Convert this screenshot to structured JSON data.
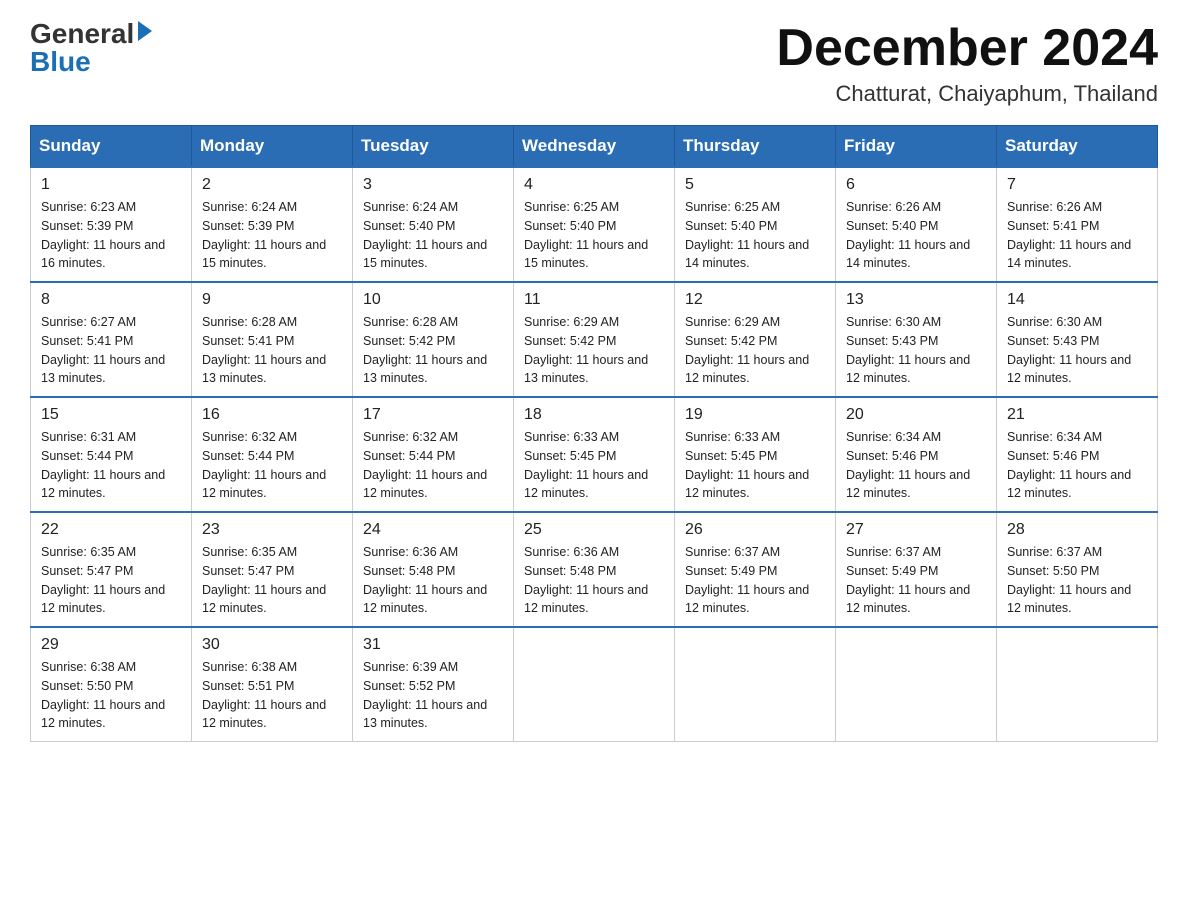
{
  "logo": {
    "general": "General",
    "blue": "Blue"
  },
  "title": {
    "month_year": "December 2024",
    "location": "Chatturat, Chaiyaphum, Thailand"
  },
  "headers": [
    "Sunday",
    "Monday",
    "Tuesday",
    "Wednesday",
    "Thursday",
    "Friday",
    "Saturday"
  ],
  "weeks": [
    [
      {
        "day": "1",
        "sunrise": "6:23 AM",
        "sunset": "5:39 PM",
        "daylight": "11 hours and 16 minutes."
      },
      {
        "day": "2",
        "sunrise": "6:24 AM",
        "sunset": "5:39 PM",
        "daylight": "11 hours and 15 minutes."
      },
      {
        "day": "3",
        "sunrise": "6:24 AM",
        "sunset": "5:40 PM",
        "daylight": "11 hours and 15 minutes."
      },
      {
        "day": "4",
        "sunrise": "6:25 AM",
        "sunset": "5:40 PM",
        "daylight": "11 hours and 15 minutes."
      },
      {
        "day": "5",
        "sunrise": "6:25 AM",
        "sunset": "5:40 PM",
        "daylight": "11 hours and 14 minutes."
      },
      {
        "day": "6",
        "sunrise": "6:26 AM",
        "sunset": "5:40 PM",
        "daylight": "11 hours and 14 minutes."
      },
      {
        "day": "7",
        "sunrise": "6:26 AM",
        "sunset": "5:41 PM",
        "daylight": "11 hours and 14 minutes."
      }
    ],
    [
      {
        "day": "8",
        "sunrise": "6:27 AM",
        "sunset": "5:41 PM",
        "daylight": "11 hours and 13 minutes."
      },
      {
        "day": "9",
        "sunrise": "6:28 AM",
        "sunset": "5:41 PM",
        "daylight": "11 hours and 13 minutes."
      },
      {
        "day": "10",
        "sunrise": "6:28 AM",
        "sunset": "5:42 PM",
        "daylight": "11 hours and 13 minutes."
      },
      {
        "day": "11",
        "sunrise": "6:29 AM",
        "sunset": "5:42 PM",
        "daylight": "11 hours and 13 minutes."
      },
      {
        "day": "12",
        "sunrise": "6:29 AM",
        "sunset": "5:42 PM",
        "daylight": "11 hours and 12 minutes."
      },
      {
        "day": "13",
        "sunrise": "6:30 AM",
        "sunset": "5:43 PM",
        "daylight": "11 hours and 12 minutes."
      },
      {
        "day": "14",
        "sunrise": "6:30 AM",
        "sunset": "5:43 PM",
        "daylight": "11 hours and 12 minutes."
      }
    ],
    [
      {
        "day": "15",
        "sunrise": "6:31 AM",
        "sunset": "5:44 PM",
        "daylight": "11 hours and 12 minutes."
      },
      {
        "day": "16",
        "sunrise": "6:32 AM",
        "sunset": "5:44 PM",
        "daylight": "11 hours and 12 minutes."
      },
      {
        "day": "17",
        "sunrise": "6:32 AM",
        "sunset": "5:44 PM",
        "daylight": "11 hours and 12 minutes."
      },
      {
        "day": "18",
        "sunrise": "6:33 AM",
        "sunset": "5:45 PM",
        "daylight": "11 hours and 12 minutes."
      },
      {
        "day": "19",
        "sunrise": "6:33 AM",
        "sunset": "5:45 PM",
        "daylight": "11 hours and 12 minutes."
      },
      {
        "day": "20",
        "sunrise": "6:34 AM",
        "sunset": "5:46 PM",
        "daylight": "11 hours and 12 minutes."
      },
      {
        "day": "21",
        "sunrise": "6:34 AM",
        "sunset": "5:46 PM",
        "daylight": "11 hours and 12 minutes."
      }
    ],
    [
      {
        "day": "22",
        "sunrise": "6:35 AM",
        "sunset": "5:47 PM",
        "daylight": "11 hours and 12 minutes."
      },
      {
        "day": "23",
        "sunrise": "6:35 AM",
        "sunset": "5:47 PM",
        "daylight": "11 hours and 12 minutes."
      },
      {
        "day": "24",
        "sunrise": "6:36 AM",
        "sunset": "5:48 PM",
        "daylight": "11 hours and 12 minutes."
      },
      {
        "day": "25",
        "sunrise": "6:36 AM",
        "sunset": "5:48 PM",
        "daylight": "11 hours and 12 minutes."
      },
      {
        "day": "26",
        "sunrise": "6:37 AM",
        "sunset": "5:49 PM",
        "daylight": "11 hours and 12 minutes."
      },
      {
        "day": "27",
        "sunrise": "6:37 AM",
        "sunset": "5:49 PM",
        "daylight": "11 hours and 12 minutes."
      },
      {
        "day": "28",
        "sunrise": "6:37 AM",
        "sunset": "5:50 PM",
        "daylight": "11 hours and 12 minutes."
      }
    ],
    [
      {
        "day": "29",
        "sunrise": "6:38 AM",
        "sunset": "5:50 PM",
        "daylight": "11 hours and 12 minutes."
      },
      {
        "day": "30",
        "sunrise": "6:38 AM",
        "sunset": "5:51 PM",
        "daylight": "11 hours and 12 minutes."
      },
      {
        "day": "31",
        "sunrise": "6:39 AM",
        "sunset": "5:52 PM",
        "daylight": "11 hours and 13 minutes."
      },
      null,
      null,
      null,
      null
    ]
  ]
}
